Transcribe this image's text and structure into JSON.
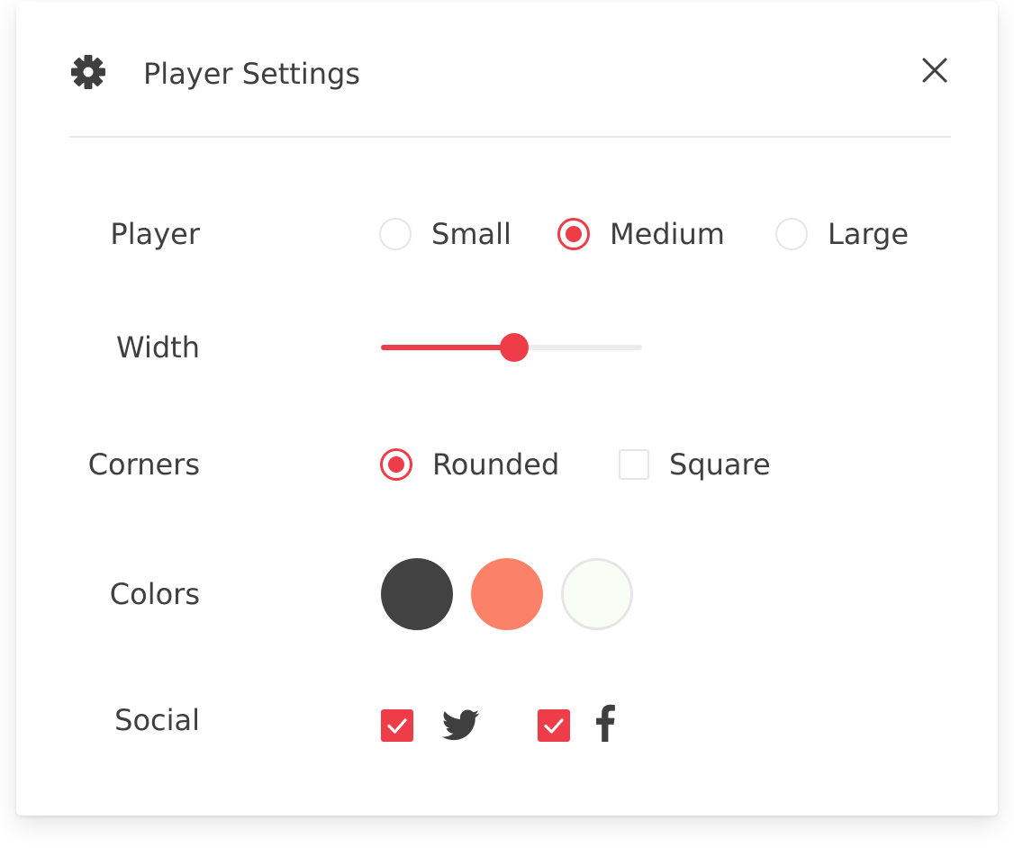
{
  "header": {
    "title": "Player Settings",
    "icon": "gear-icon",
    "close_icon": "close-icon"
  },
  "rows": {
    "player": {
      "label": "Player",
      "options": [
        {
          "label": "Small",
          "checked": false
        },
        {
          "label": "Medium",
          "checked": true
        },
        {
          "label": "Large",
          "checked": false
        }
      ]
    },
    "width": {
      "label": "Width",
      "value_percent": 51
    },
    "corners": {
      "label": "Corners",
      "options": [
        {
          "label": "Rounded",
          "checked": true
        },
        {
          "label": "Square",
          "checked": false
        }
      ]
    },
    "colors": {
      "label": "Colors",
      "swatches": [
        "#424243",
        "#fb8168",
        "#f8fdf5"
      ]
    },
    "social": {
      "label": "Social",
      "items": [
        {
          "icon": "twitter-icon",
          "checked": true
        },
        {
          "icon": "facebook-icon",
          "checked": true
        }
      ]
    }
  },
  "theme": {
    "accent": "#ee3d48",
    "text": "#3f3f3f",
    "border": "#e6e6e6"
  }
}
